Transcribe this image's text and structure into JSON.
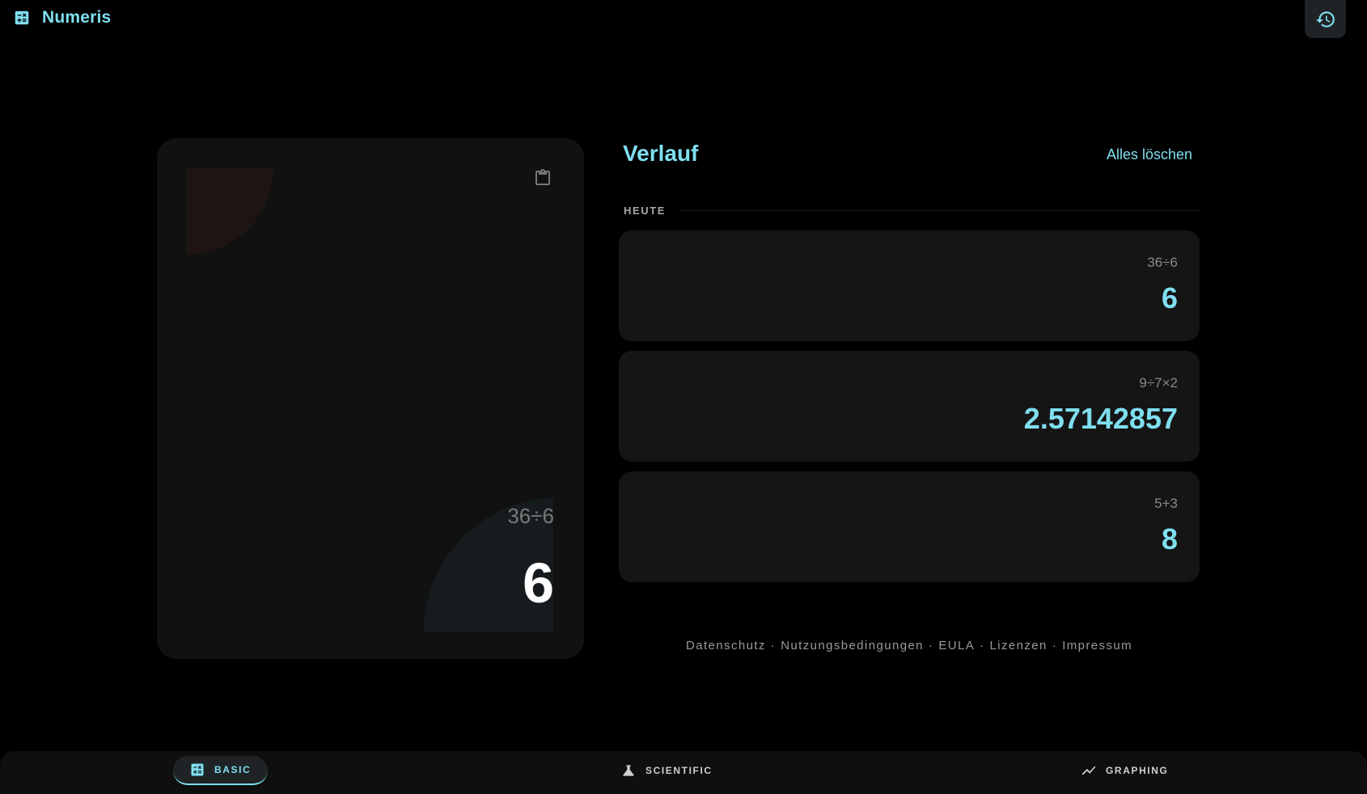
{
  "app": {
    "title": "Numeris"
  },
  "display": {
    "expression": "36÷6",
    "result": "6"
  },
  "history": {
    "title": "Verlauf",
    "clear_label": "Alles löschen",
    "section_label": "HEUTE",
    "entries": [
      {
        "expression": "36÷6",
        "result": "6"
      },
      {
        "expression": "9÷7×2",
        "result": "2.57142857"
      },
      {
        "expression": "5+3",
        "result": "8"
      }
    ]
  },
  "footer": {
    "links": [
      "Datenschutz",
      "Nutzungsbedingungen",
      "EULA",
      "Lizenzen",
      "Impressum"
    ],
    "separator": "·"
  },
  "nav": {
    "items": [
      {
        "label": "BASIC",
        "icon": "calculator-icon",
        "active": true
      },
      {
        "label": "SCIENTIFIC",
        "icon": "flask-icon",
        "active": false
      },
      {
        "label": "GRAPHING",
        "icon": "trending-line-icon",
        "active": false
      }
    ]
  },
  "colors": {
    "accent": "#7fdff0",
    "background": "#000000",
    "card": "#111111",
    "entry": "#151515"
  }
}
